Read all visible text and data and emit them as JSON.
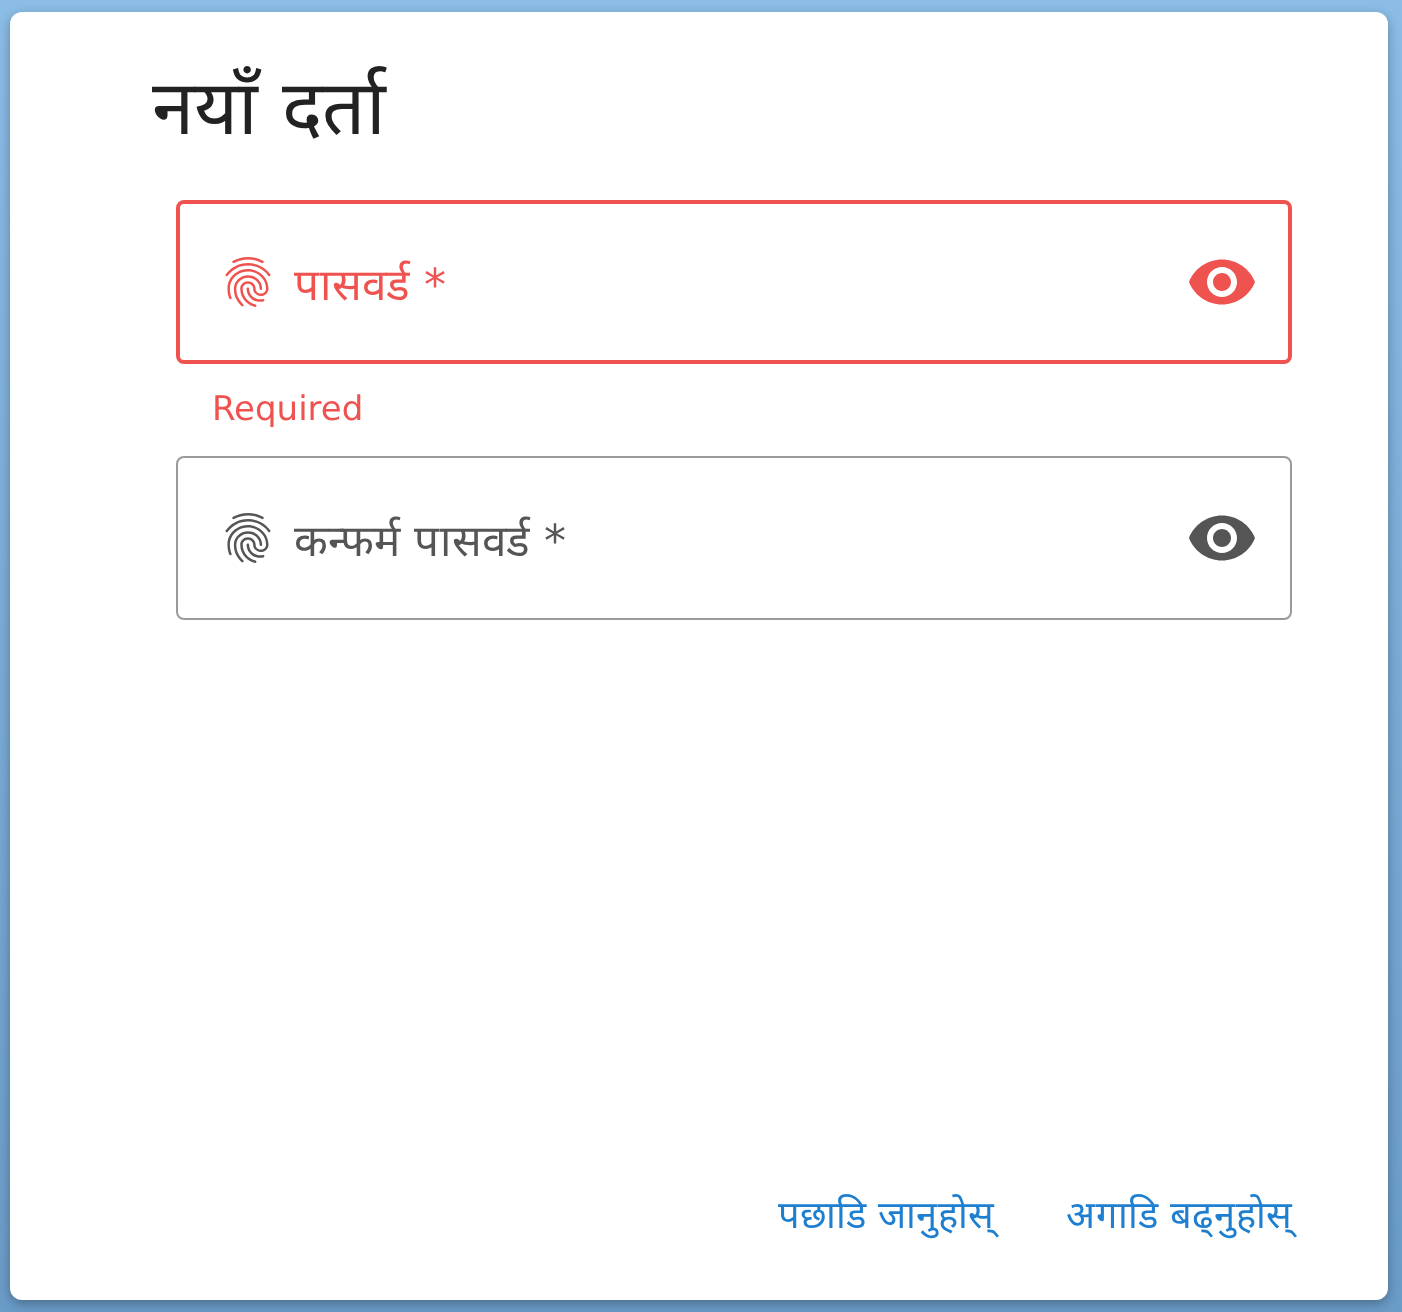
{
  "dialog": {
    "title": "नयाँ दर्ता",
    "fields": [
      {
        "label": "पासवर्ड *",
        "invalid": true,
        "error": "Required"
      },
      {
        "label": "कन्फर्म पासवर्ड *",
        "invalid": false
      }
    ],
    "buttons": [
      "पछाडि जानुहोस्",
      "अगाडि बढ्नुहोस्"
    ]
  }
}
